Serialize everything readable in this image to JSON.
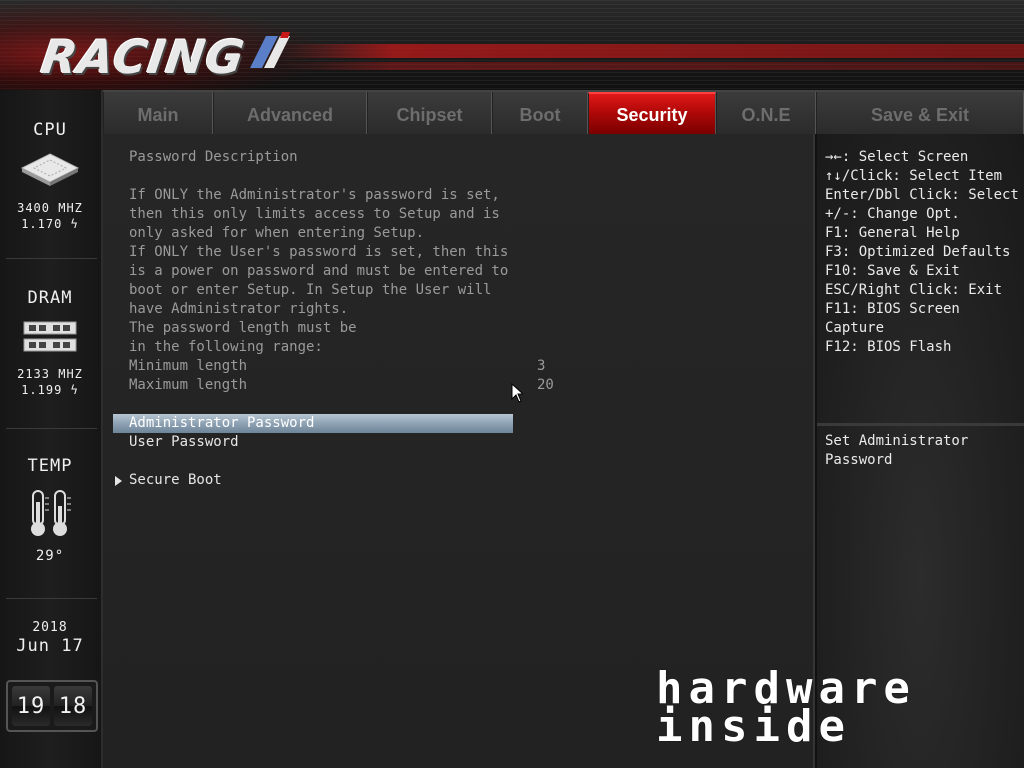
{
  "brand": {
    "logo_text": "RACING"
  },
  "sidebar": {
    "cpu": {
      "title": "CPU",
      "freq": "3400 MHZ",
      "volt": "1.170 ϟ"
    },
    "dram": {
      "title": "DRAM",
      "freq": "2133 MHZ",
      "volt": "1.199 ϟ"
    },
    "temp": {
      "title": "TEMP",
      "value": "29°"
    },
    "date": {
      "year": "2018",
      "day": "Jun 17"
    },
    "clock": {
      "hours": "19",
      "minutes": "18"
    }
  },
  "tabs": [
    {
      "label": "Main"
    },
    {
      "label": "Advanced"
    },
    {
      "label": "Chipset"
    },
    {
      "label": "Boot"
    },
    {
      "label": "Security"
    },
    {
      "label": "O.N.E"
    },
    {
      "label": "Save & Exit"
    }
  ],
  "active_tab": "Security",
  "main": {
    "description_title": "Password Description",
    "description_lines": [
      "If ONLY the Administrator's password is set,",
      "then this only limits access to Setup and is",
      "only asked for when entering Setup.",
      "If ONLY the User's password is set, then this",
      "is a power on password and must be entered to",
      "boot or enter Setup. In Setup the User will",
      "have Administrator rights.",
      "The password length must be",
      "in the following range:"
    ],
    "range": [
      {
        "label": "Minimum length",
        "value": "3"
      },
      {
        "label": "Maximum length",
        "value": "20"
      }
    ],
    "items": [
      {
        "label": "Administrator Password",
        "selected": true
      },
      {
        "label": "User Password",
        "selected": false
      }
    ],
    "submenu": {
      "label": "Secure Boot"
    }
  },
  "help": {
    "keys": [
      "→←: Select Screen",
      "↑↓/Click: Select Item",
      "Enter/Dbl Click: Select",
      "+/-: Change Opt.",
      "F1: General Help",
      "F3: Optimized Defaults",
      "F10: Save & Exit",
      "ESC/Right Click: Exit",
      "F11: BIOS Screen",
      "Capture",
      "F12: BIOS Flash"
    ],
    "item_help": [
      "Set Administrator",
      "Password"
    ]
  },
  "watermark": {
    "line1": "hardware",
    "line2": "inside"
  },
  "colors": {
    "accent": "#c00a0a",
    "selection": "#8ea2b4",
    "text": "#e6e6e6",
    "muted": "#9a9a9a"
  }
}
